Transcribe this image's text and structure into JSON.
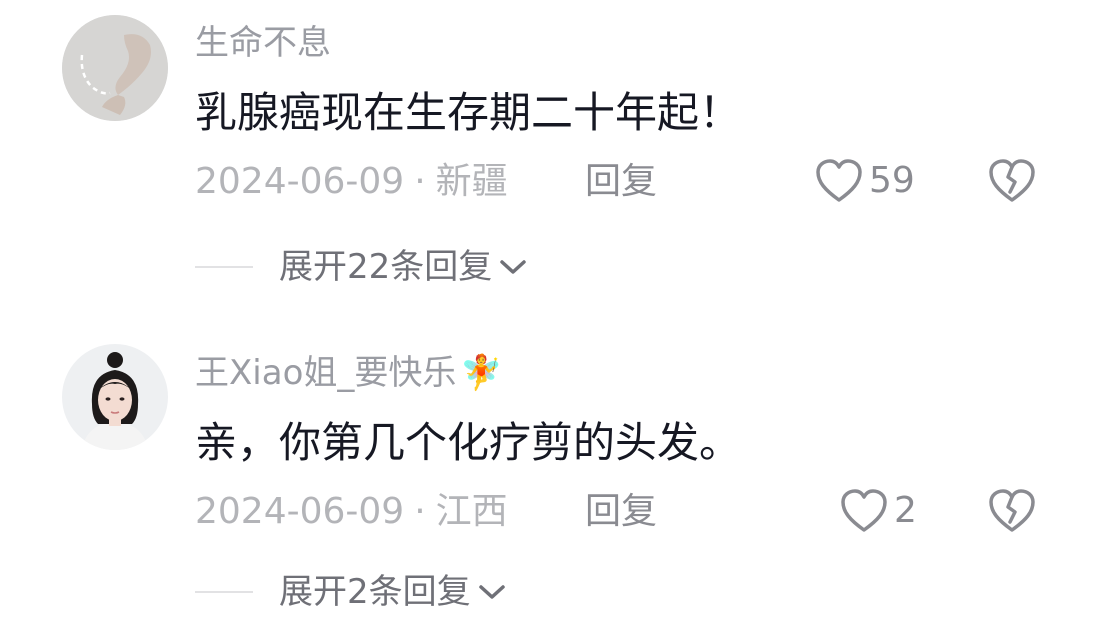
{
  "comments": [
    {
      "username": "生命不息",
      "content": "乳腺癌现在生存期二十年起！",
      "date": "2024-06-09",
      "separator": "·",
      "location": "新疆",
      "reply_label": "回复",
      "like_count": "59",
      "expand_label": "展开22条回复",
      "avatar_icon": "hand-heart-avatar"
    },
    {
      "username": "王Xiao姐_要快乐",
      "username_emoji": "🧚",
      "content": "亲，你第几个化疗剪的头发。",
      "date": "2024-06-09",
      "separator": "·",
      "location": "江西",
      "reply_label": "回复",
      "like_count": "2",
      "expand_label": "展开2条回复",
      "avatar_icon": "girl-portrait-avatar"
    }
  ],
  "colors": {
    "text_primary": "#161823",
    "text_secondary": "#9a9ca3",
    "icon": "#8a8b91"
  }
}
